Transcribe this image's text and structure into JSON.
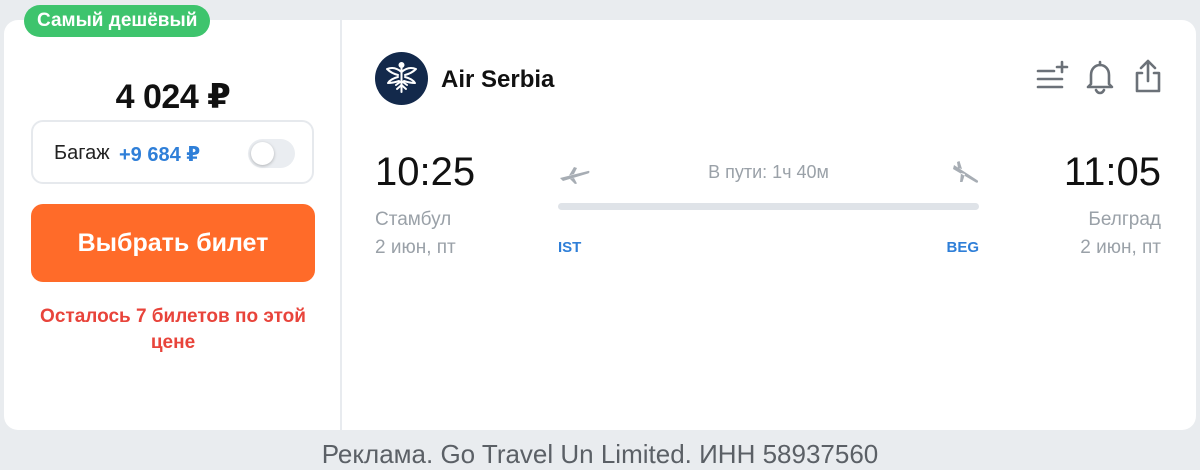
{
  "badge": "Самый дешёвый",
  "price": "4 024 ₽",
  "baggage": {
    "label": "Багаж",
    "price": "+9 684 ₽",
    "enabled": false
  },
  "buy_button": "Выбрать билет",
  "tickets_left": "Осталось 7 билетов по этой цене",
  "airline": {
    "name": "Air Serbia",
    "logo_icon": "air-serbia-eagle-logo"
  },
  "actions": {
    "icons": [
      "add-to-list-icon",
      "bell-icon",
      "share-icon"
    ]
  },
  "flight": {
    "departure": {
      "time": "10:25",
      "city": "Стамбул",
      "date": "2 июн, пт",
      "code": "IST"
    },
    "arrival": {
      "time": "11:05",
      "city": "Белград",
      "date": "2 июн, пт",
      "code": "BEG"
    },
    "duration": "В пути: 1ч 40м"
  },
  "footer": "Реклама. Go Travel Un Limited. ИНН 58937560",
  "colors": {
    "badge": "#3ec46d",
    "buy_button": "#ff6b29",
    "accent_blue": "#2f7fd8",
    "warning_red": "#e8443b",
    "logo_bg": "#13294b"
  }
}
